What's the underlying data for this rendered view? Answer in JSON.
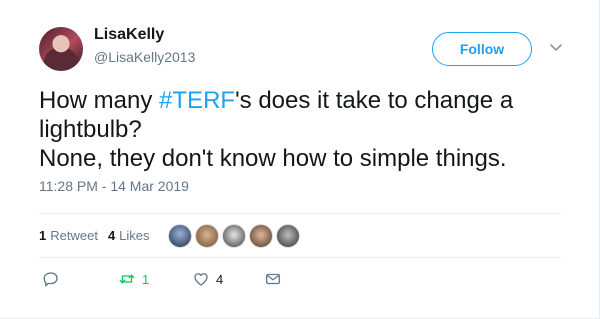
{
  "user": {
    "display_name": "LisaKelly",
    "handle": "@LisaKelly2013"
  },
  "follow_button": {
    "label": "Follow"
  },
  "tweet": {
    "text_prefix": "How many ",
    "hashtag": "#TERF",
    "text_line1_suffix": "'s does it take to change a",
    "text_line2": "lightbulb?",
    "text_line3": "None, they don't know how to simple things.",
    "timestamp": "11:28 PM - 14 Mar 2019"
  },
  "stats": {
    "retweets_count": "1",
    "retweets_label": "Retweet",
    "likes_count": "4",
    "likes_label": "Likes"
  },
  "actions": {
    "retweet_count": "1",
    "like_count": "4"
  },
  "colors": {
    "accent": "#1da1f2",
    "retweet_green": "#17bf63",
    "muted": "#657786"
  }
}
